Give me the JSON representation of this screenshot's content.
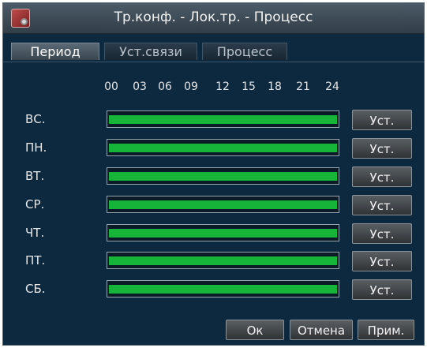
{
  "window": {
    "title": "Тр.конф. - Лок.тр. - Процесс"
  },
  "tabs": [
    {
      "label": "Период",
      "active": true
    },
    {
      "label": "Уст.связи",
      "active": false
    },
    {
      "label": "Процесс",
      "active": false
    }
  ],
  "hours": [
    "00",
    "03",
    "06",
    "09",
    "12",
    "15",
    "18",
    "21",
    "24"
  ],
  "days": [
    {
      "label": "ВС.",
      "coverage": 1.0,
      "button": "Уст."
    },
    {
      "label": "ПН.",
      "coverage": 1.0,
      "button": "Уст."
    },
    {
      "label": "ВТ.",
      "coverage": 1.0,
      "button": "Уст."
    },
    {
      "label": "СР.",
      "coverage": 1.0,
      "button": "Уст."
    },
    {
      "label": "ЧТ.",
      "coverage": 1.0,
      "button": "Уст."
    },
    {
      "label": "ПТ.",
      "coverage": 1.0,
      "button": "Уст."
    },
    {
      "label": "СБ.",
      "coverage": 1.0,
      "button": "Уст."
    }
  ],
  "footer": {
    "ok_label": "Ок",
    "cancel_label": "Отмена",
    "apply_label": "Прим."
  },
  "colors": {
    "schedule_fill": "#16b53a",
    "background": "#0d2940"
  }
}
